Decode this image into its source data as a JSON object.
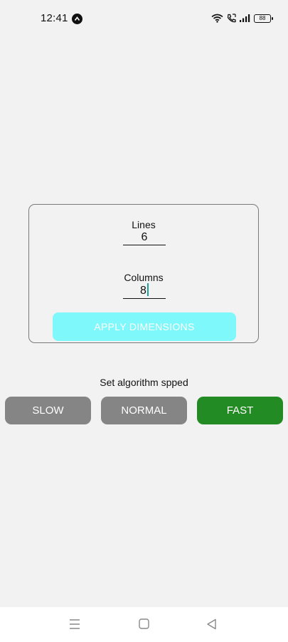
{
  "status_bar": {
    "time": "12:41",
    "battery": "88",
    "icons": [
      "app-notification-icon",
      "wifi-icon",
      "call-icon",
      "signal-icon",
      "battery-icon"
    ]
  },
  "dimensions": {
    "lines_label": "Lines",
    "lines_value": "6",
    "columns_label": "Columns",
    "columns_value": "8",
    "apply_label": "APPLY DIMENSIONS"
  },
  "speed": {
    "title": "Set algorithm spped",
    "slow_label": "SLOW",
    "normal_label": "NORMAL",
    "fast_label": "FAST",
    "selected": "FAST"
  },
  "colors": {
    "background": "#f2f2f2",
    "apply_button": "#7ff8fb",
    "speed_unselected": "#858585",
    "speed_selected": "#238b23"
  },
  "nav_bar": {
    "icons": [
      "menu-icon",
      "home-icon",
      "back-icon"
    ]
  }
}
